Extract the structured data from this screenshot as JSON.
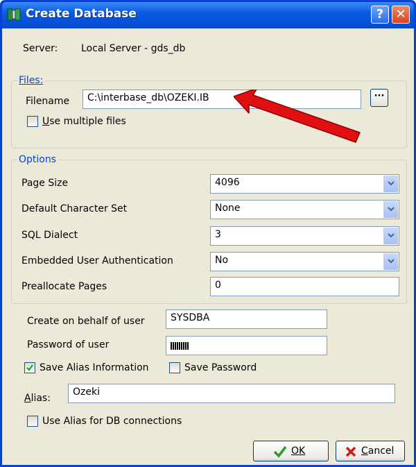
{
  "window": {
    "title": "Create Database",
    "help_label": "?",
    "close_label": "✕"
  },
  "server": {
    "label": "Server:",
    "value": "Local Server - gds_db"
  },
  "files": {
    "legend": "Files:",
    "filename_label": "Filename",
    "filename_value": "C:\\interbase_db\\OZEKI.IB",
    "browse_label": "···",
    "use_multiple_label": "Use multiple files",
    "use_multiple_checked": false
  },
  "options": {
    "legend": "Options",
    "page_size": {
      "label": "Page Size",
      "value": "4096"
    },
    "charset": {
      "label": "Default Character Set",
      "value": "None"
    },
    "dialect": {
      "label": "SQL Dialect",
      "value": "3"
    },
    "embedded_auth": {
      "label": "Embedded User Authentication",
      "value": "No"
    },
    "preallocate": {
      "label": "Preallocate Pages",
      "value": "0"
    }
  },
  "user": {
    "behalf_label": "Create on behalf of user",
    "behalf_value": "SYSDBA",
    "password_label": "Password of user",
    "password_mask_length": 9
  },
  "alias": {
    "save_alias_label": "Save Alias Information",
    "save_alias_checked": true,
    "save_password_label": "Save Password",
    "save_password_checked": false,
    "alias_label": "Alias:",
    "alias_value": "Ozeki",
    "use_alias_label": "Use Alias for DB connections",
    "use_alias_checked": false
  },
  "buttons": {
    "ok_label": "OK",
    "cancel_label": "Cancel"
  },
  "annotation": {
    "arrow_color": "#e01010"
  }
}
